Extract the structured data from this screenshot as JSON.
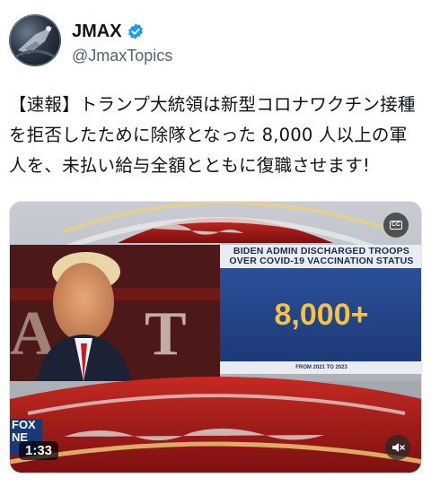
{
  "author": {
    "display_name": "JMAX",
    "handle": "@JmaxTopics",
    "verified": true,
    "avatar_icon": "avatar-image"
  },
  "tweet": {
    "text": "【速報】トランプ大統領は新型コロナワクチン接種を拒否したために除隊となった 8,000 人以上の軍人を、未払い給与全額とともに復職させます!"
  },
  "video": {
    "duration": "1:33",
    "cc_label": "CC",
    "overlay": {
      "headline_line1": "BIDEN ADMIN DISCHARGED TROOPS",
      "headline_line2": "OVER COVID-19 VACCINATION STATUS",
      "count": "8,000+",
      "footnote": "FROM 2021 TO 2023"
    },
    "network_logo_text": [
      "FOX",
      "NE"
    ]
  },
  "colors": {
    "verified_blue": "#1d9bf0",
    "handle_gray": "#536471",
    "text_dark": "#0f1419",
    "panel_blue": "#2a4f9a",
    "count_gold": "#f5c242",
    "broadcast_red": "#a01818"
  }
}
